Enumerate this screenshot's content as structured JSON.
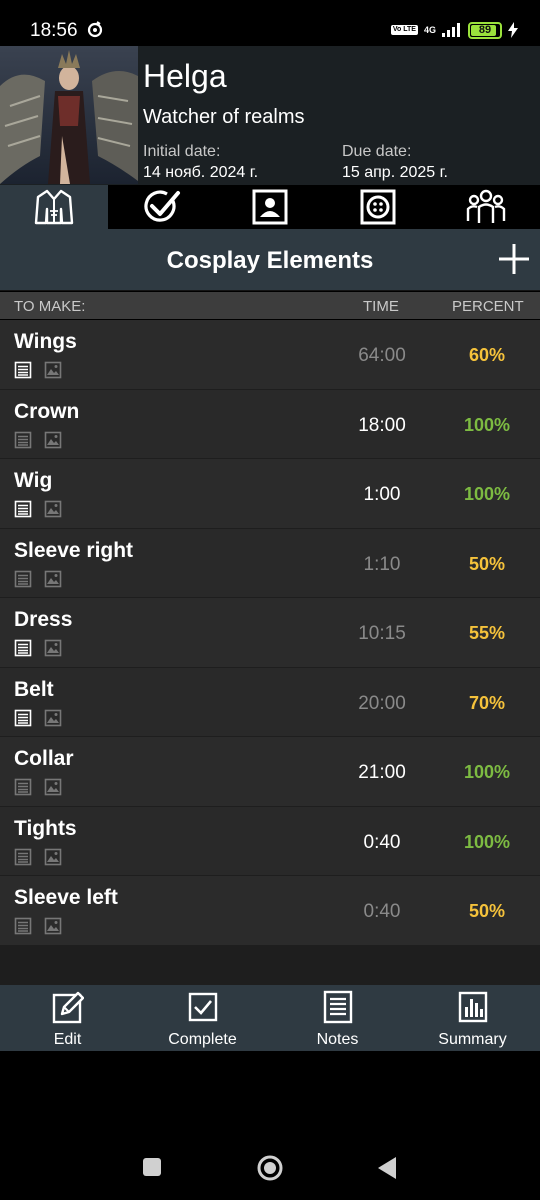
{
  "status_bar": {
    "time": "18:56",
    "volte": "Vo LTE",
    "network": "4G",
    "battery": "89",
    "battery_level": 0.89
  },
  "project": {
    "name": "Helga",
    "subtitle": "Watcher of realms",
    "initial_label": "Initial date:",
    "initial_date": "14 нояб. 2024 г.",
    "due_label": "Due date:",
    "due_date": "15 апр. 2025 г."
  },
  "tabs": [
    {
      "icon": "costume-icon",
      "active": true
    },
    {
      "icon": "checkmark-icon",
      "active": false
    },
    {
      "icon": "character-portrait-icon",
      "active": false
    },
    {
      "icon": "button-icon",
      "active": false
    },
    {
      "icon": "group-icon",
      "active": false
    }
  ],
  "section": {
    "title": "Cosplay Elements",
    "add_icon": "plus-icon"
  },
  "columns": {
    "to_make": "TO MAKE:",
    "time": "TIME",
    "percent": "PERCENT"
  },
  "elements": [
    {
      "name": "Wings",
      "time": "64:00",
      "percent": "60%",
      "has_notes": true,
      "has_image": false,
      "done": false
    },
    {
      "name": "Crown",
      "time": "18:00",
      "percent": "100%",
      "has_notes": false,
      "has_image": false,
      "done": true
    },
    {
      "name": "Wig",
      "time": "1:00",
      "percent": "100%",
      "has_notes": true,
      "has_image": false,
      "done": true
    },
    {
      "name": "Sleeve right",
      "time": "1:10",
      "percent": "50%",
      "has_notes": false,
      "has_image": false,
      "done": false
    },
    {
      "name": "Dress",
      "time": "10:15",
      "percent": "55%",
      "has_notes": true,
      "has_image": false,
      "done": false
    },
    {
      "name": "Belt",
      "time": "20:00",
      "percent": "70%",
      "has_notes": true,
      "has_image": false,
      "done": false
    },
    {
      "name": "Collar",
      "time": "21:00",
      "percent": "100%",
      "has_notes": false,
      "has_image": false,
      "done": true
    },
    {
      "name": "Tights",
      "time": "0:40",
      "percent": "100%",
      "has_notes": false,
      "has_image": false,
      "done": true
    },
    {
      "name": "Sleeve left",
      "time": "0:40",
      "percent": "50%",
      "has_notes": false,
      "has_image": false,
      "done": false
    }
  ],
  "bottom_bar": [
    {
      "label": "Edit",
      "icon": "edit-icon"
    },
    {
      "label": "Complete",
      "icon": "checkbox-icon"
    },
    {
      "label": "Notes",
      "icon": "notes-icon"
    },
    {
      "label": "Summary",
      "icon": "summary-chart-icon"
    }
  ],
  "colors": {
    "header_bg": "#1b2023",
    "bar_bg": "#2f3a42",
    "done": "#7dbb42",
    "partial": "#f5c23b",
    "battery": "#9be23c"
  }
}
